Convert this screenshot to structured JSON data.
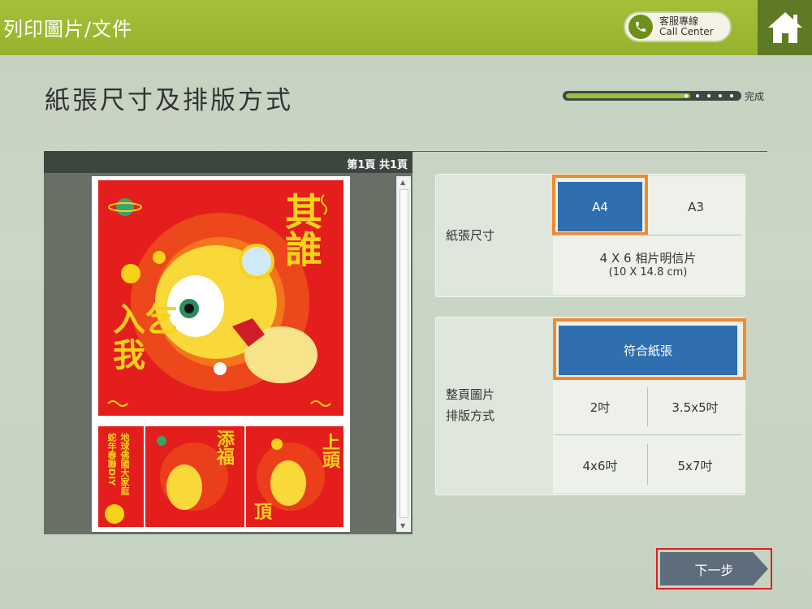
{
  "header": {
    "breadcrumb": "列印圖片/文件",
    "call_center_zh": "客服專線",
    "call_center_en": "Call Center",
    "home_icon": "home-icon"
  },
  "page": {
    "title": "紙張尺寸及排版方式",
    "progress_label": "完成",
    "progress_fraction": 0.72
  },
  "preview": {
    "page_indicator": "第1頁  共1頁",
    "poster_chars_top": "其誰",
    "poster_chars_left": "入乞我",
    "strip1_text": "地球佛國大家庭 蛇年春聯DIY",
    "strip2_text": "添福",
    "strip3_text": "上頭",
    "strip3_text2": "頂"
  },
  "paper_size": {
    "label": "紙張尺寸",
    "options": {
      "a4": "A4",
      "a3": "A3",
      "postcard_main": "4 X 6 相片明信片",
      "postcard_sub": "(10 X 14.8 cm)"
    },
    "selected": "A4"
  },
  "layout": {
    "label_line1": "整頁圖片",
    "label_line2": "排版方式",
    "options": {
      "fit": "符合紙張",
      "two_inch": "2吋",
      "three_five": "3.5x5吋",
      "four_six": "4x6吋",
      "five_seven": "5x7吋"
    },
    "selected": "符合紙張"
  },
  "footer": {
    "next_label": "下一步"
  },
  "colors": {
    "header_green": "#a6bf3a",
    "selected_blue": "#2f6faf",
    "highlight_orange": "#f2892a",
    "highlight_red": "#e02020",
    "poster_red": "#e41d1d"
  }
}
